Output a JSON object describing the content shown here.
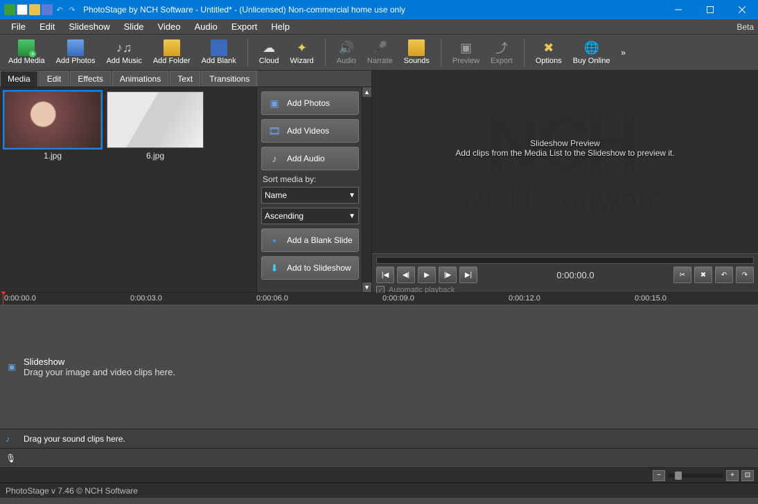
{
  "titlebar": {
    "title": "PhotoStage by NCH Software - Untitled* - (Unlicensed) Non-commercial home use only"
  },
  "menu": {
    "items": [
      "File",
      "Edit",
      "Slideshow",
      "Slide",
      "Video",
      "Audio",
      "Export",
      "Help"
    ],
    "beta": "Beta"
  },
  "toolbar": {
    "add_media": "Add Media",
    "add_photos": "Add Photos",
    "add_music": "Add Music",
    "add_folder": "Add Folder",
    "add_blank": "Add Blank",
    "cloud": "Cloud",
    "wizard": "Wizard",
    "audio": "Audio",
    "narrate": "Narrate",
    "sounds": "Sounds",
    "preview": "Preview",
    "export": "Export",
    "options": "Options",
    "buy_online": "Buy Online"
  },
  "tabs": {
    "items": [
      "Media",
      "Edit",
      "Effects",
      "Animations",
      "Text",
      "Transitions"
    ],
    "active": "Media"
  },
  "media_list": {
    "thumbs": [
      {
        "name": "1.jpg"
      },
      {
        "name": "6.jpg"
      }
    ]
  },
  "actions": {
    "add_photos": "Add Photos",
    "add_videos": "Add Videos",
    "add_audio": "Add Audio",
    "sort_label": "Sort media by:",
    "sort_field": "Name",
    "sort_order": "Ascending",
    "add_blank_slide": "Add a Blank Slide",
    "add_to_slideshow": "Add to Slideshow"
  },
  "preview": {
    "title": "Slideshow Preview",
    "hint": "Add clips from the Media List to the Slideshow to preview it.",
    "nch_text": "NCH Software",
    "time": "0:00:00.0",
    "auto_play": "Automatic playback"
  },
  "ruler_times": [
    "0:00:00.0",
    "0:00:03.0",
    "0:00:06.0",
    "0:00:09.0",
    "0:00:12.0",
    "0:00:15.0"
  ],
  "video_track": {
    "title": "Slideshow",
    "hint": "Drag your image and video clips here."
  },
  "audio_track": {
    "hint": "Drag your sound clips here."
  },
  "status": "PhotoStage v 7.46 © NCH Software"
}
